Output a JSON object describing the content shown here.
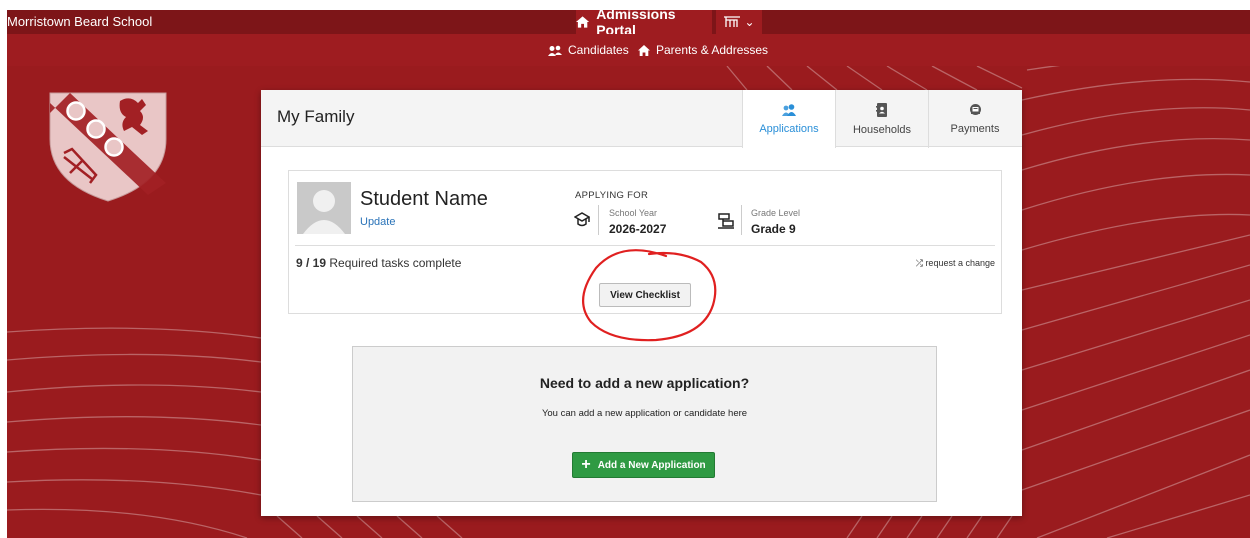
{
  "topbar": {
    "school_name": "Morristown Beard School",
    "portal_label": "Admissions Portal",
    "home_icon": "home-icon",
    "logo_icon": "school-logo-icon",
    "dropdown_icon": "chevron-down-icon"
  },
  "subnav": {
    "items": [
      {
        "label": "Candidates",
        "icon": "users-icon"
      },
      {
        "label": "Parents & Addresses",
        "icon": "home-icon"
      }
    ]
  },
  "card": {
    "title": "My Family",
    "tabs": [
      {
        "label": "Applications",
        "icon": "users-icon",
        "active": true
      },
      {
        "label": "Households",
        "icon": "address-book-icon",
        "active": false
      },
      {
        "label": "Payments",
        "icon": "cash-register-icon",
        "active": false
      }
    ]
  },
  "application": {
    "student_name": "Student Name",
    "update_label": "Update",
    "applying_for_label": "APPLYING FOR",
    "school_year_label": "School Year",
    "school_year_value": "2026-2027",
    "grade_level_label": "Grade Level",
    "grade_level_value": "Grade 9",
    "tasks_count": "9 / 19",
    "tasks_label": "Required tasks complete",
    "request_change_label": "request a change",
    "view_checklist_label": "View Checklist"
  },
  "new_application": {
    "title": "Need to add a new application?",
    "subtitle": "You can add a new application or candidate here",
    "button_label": "Add a New Application"
  },
  "colors": {
    "background_red": "#9a1b1e",
    "topbar_red": "#7d1518",
    "link_blue": "#2a73b8",
    "active_tab_blue": "#2a8fd8",
    "add_button_green": "#2f9a43",
    "annotation_red": "#e02020"
  }
}
